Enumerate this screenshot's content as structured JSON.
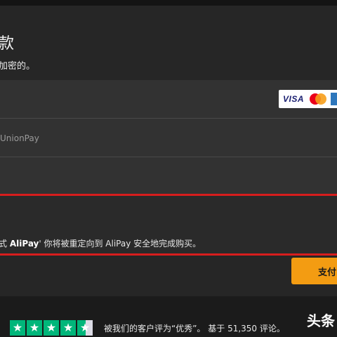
{
  "header": {
    "title": "款",
    "subtitle": "加密的。"
  },
  "payment_options": {
    "card": {
      "brands": [
        "VISA",
        "Mastercard",
        "American Express"
      ],
      "visa_label": "VISA"
    },
    "unionpay": {
      "label": "UnionPay"
    },
    "alipay": {
      "prefix": "式 ",
      "name": "AliPay",
      "suffix": "' 你将被重定向到 AliPay 安全地完成购买。"
    }
  },
  "pay_button": {
    "label": "支付"
  },
  "rating": {
    "text": "被我们的客户评为“优秀”。 基于 51,350 评论。",
    "stars": 4.5
  },
  "watermark": {
    "text": "头条"
  },
  "colors": {
    "accent": "#f39c12",
    "highlight_border": "#d71d1d",
    "trustpilot_green": "#00b67a"
  }
}
